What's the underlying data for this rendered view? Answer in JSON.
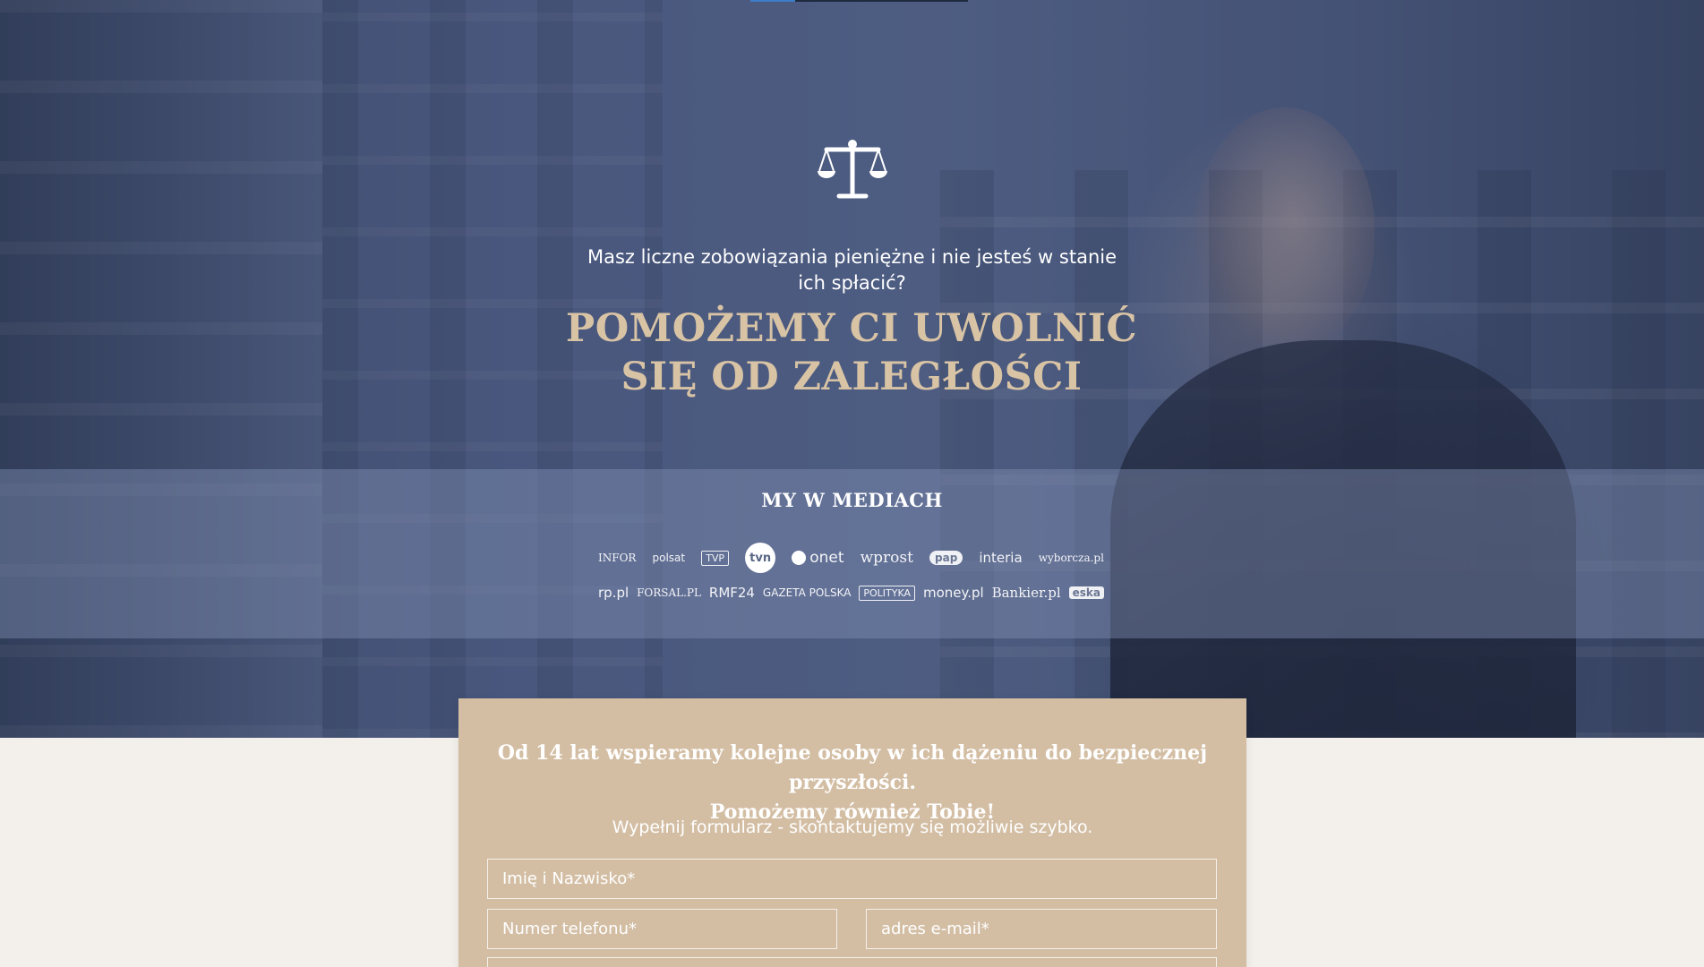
{
  "hero": {
    "subtitle": "Masz liczne zobowiązania pieniężne i nie jesteś w stanie ich spłacić?",
    "title_line1": "POMOŻEMY CI UWOLNIĆ",
    "title_line2": "SIĘ OD ZALEGŁOŚCI",
    "icon": "scales-of-justice-icon",
    "accent_color": "#d8c3a5"
  },
  "media": {
    "title": "MY W MEDIACH",
    "row1": [
      "INFOR",
      "polsat",
      "TVP",
      "tvn",
      "onet",
      "wprost",
      "pap",
      "interia",
      "wyborcza.pl"
    ],
    "row2": [
      "rp.pl",
      "FORSAL.PL",
      "RMF24",
      "GAZETA POLSKA",
      "POLITYKA",
      "money.pl",
      "Bankier.pl",
      "eska"
    ]
  },
  "form": {
    "heading_line1": "Od 14 lat wspieramy kolejne osoby w ich dążeniu do bezpiecznej przyszłości.",
    "heading_line2": "Pomożemy również Tobie!",
    "subtitle": "Wypełnij formularz - skontaktujemy się możliwie szybko.",
    "name_placeholder": "Imię i Nazwisko*",
    "phone_placeholder": "Numer telefonu*",
    "email_placeholder": "adres e-mail*",
    "card_color": "#d3bea4"
  }
}
